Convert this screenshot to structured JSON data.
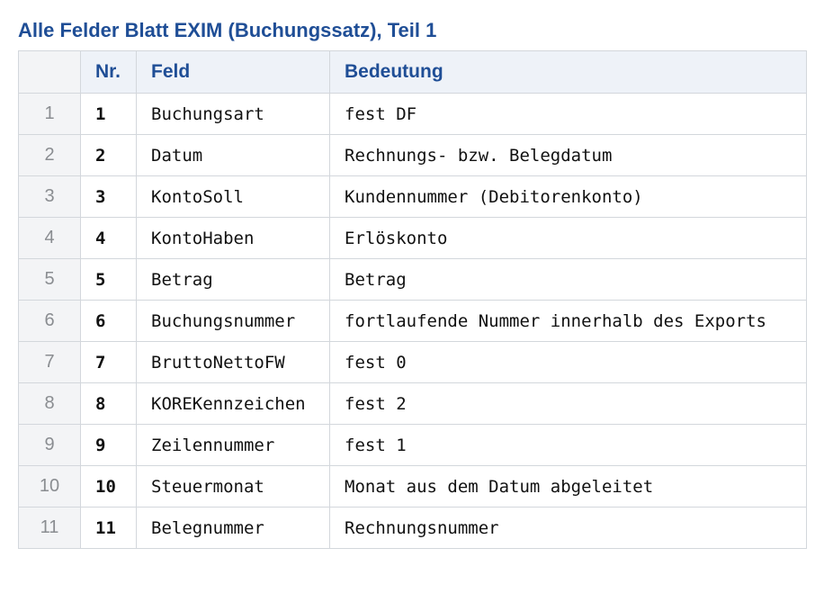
{
  "title": "Alle Felder Blatt EXIM (Buchungssatz), Teil 1",
  "table": {
    "headers": [
      "",
      "Nr.",
      "Feld",
      "Bedeutung"
    ],
    "rows": [
      {
        "row": "1",
        "nr": "1",
        "feld": "Buchungsart",
        "bedeutung": "fest DF"
      },
      {
        "row": "2",
        "nr": "2",
        "feld": "Datum",
        "bedeutung": "Rechnungs- bzw. Belegdatum"
      },
      {
        "row": "3",
        "nr": "3",
        "feld": "KontoSoll",
        "bedeutung": "Kundennummer (Debitorenkonto)"
      },
      {
        "row": "4",
        "nr": "4",
        "feld": "KontoHaben",
        "bedeutung": "Erlöskonto"
      },
      {
        "row": "5",
        "nr": "5",
        "feld": "Betrag",
        "bedeutung": "Betrag"
      },
      {
        "row": "6",
        "nr": "6",
        "feld": "Buchungsnummer",
        "bedeutung": "fortlaufende Nummer innerhalb des Exports"
      },
      {
        "row": "7",
        "nr": "7",
        "feld": "BruttoNettoFW",
        "bedeutung": "fest 0"
      },
      {
        "row": "8",
        "nr": "8",
        "feld": "KOREKennzeichen",
        "bedeutung": "fest 2"
      },
      {
        "row": "9",
        "nr": "9",
        "feld": "Zeilennummer",
        "bedeutung": "fest 1"
      },
      {
        "row": "10",
        "nr": "10",
        "feld": "Steuermonat",
        "bedeutung": "Monat aus dem Datum abgeleitet"
      },
      {
        "row": "11",
        "nr": "11",
        "feld": "Belegnummer",
        "bedeutung": "Rechnungsnummer"
      }
    ]
  },
  "colors": {
    "title": "#1f4e96",
    "header_bg": "#eef2f8",
    "rownum_bg": "#f3f4f6",
    "border": "#d3d7dc"
  }
}
